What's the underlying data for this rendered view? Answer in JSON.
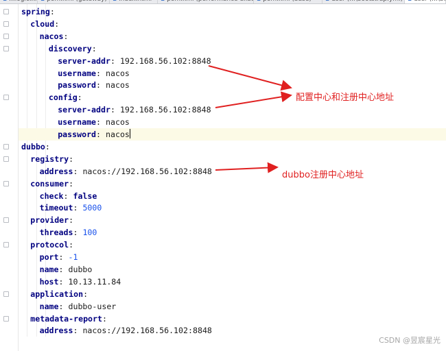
{
  "tabs": [
    {
      "label": "...logic.xml"
    },
    {
      "label": "pom.xml (gateway)"
    },
    {
      "label": "index.html"
    },
    {
      "label": "pom.xml (performance-alibaba)"
    },
    {
      "label": "pom.xml (base)"
    },
    {
      "label": "user (...\\bootstrap.yml)"
    },
    {
      "label": "user (...\\bo"
    }
  ],
  "code_lines": [
    {
      "indent": 0,
      "key": "spring",
      "value": "",
      "kind": ""
    },
    {
      "indent": 1,
      "key": "cloud",
      "value": "",
      "kind": ""
    },
    {
      "indent": 2,
      "key": "nacos",
      "value": "",
      "kind": ""
    },
    {
      "indent": 3,
      "key": "discovery",
      "value": "",
      "kind": ""
    },
    {
      "indent": 4,
      "key": "server-addr",
      "value": "192.168.56.102:8848",
      "kind": "str"
    },
    {
      "indent": 4,
      "key": "username",
      "value": "nacos",
      "kind": "str"
    },
    {
      "indent": 4,
      "key": "password",
      "value": "nacos",
      "kind": "str"
    },
    {
      "indent": 3,
      "key": "config",
      "value": "",
      "kind": ""
    },
    {
      "indent": 4,
      "key": "server-addr",
      "value": "192.168.56.102:8848",
      "kind": "str"
    },
    {
      "indent": 4,
      "key": "username",
      "value": "nacos",
      "kind": "str"
    },
    {
      "indent": 4,
      "key": "password",
      "value": "nacos",
      "kind": "str",
      "caret": true
    },
    {
      "indent": 0,
      "key": "dubbo",
      "value": "",
      "kind": ""
    },
    {
      "indent": 1,
      "key": "registry",
      "value": "",
      "kind": ""
    },
    {
      "indent": 2,
      "key": "address",
      "value": "nacos://192.168.56.102:8848",
      "kind": "str"
    },
    {
      "indent": 1,
      "key": "consumer",
      "value": "",
      "kind": ""
    },
    {
      "indent": 2,
      "key": "check",
      "value": "false",
      "kind": "bool"
    },
    {
      "indent": 2,
      "key": "timeout",
      "value": "5000",
      "kind": "num"
    },
    {
      "indent": 1,
      "key": "provider",
      "value": "",
      "kind": ""
    },
    {
      "indent": 2,
      "key": "threads",
      "value": "100",
      "kind": "num"
    },
    {
      "indent": 1,
      "key": "protocol",
      "value": "",
      "kind": ""
    },
    {
      "indent": 2,
      "key": "port",
      "value": "-1",
      "kind": "num"
    },
    {
      "indent": 2,
      "key": "name",
      "value": "dubbo",
      "kind": "str"
    },
    {
      "indent": 2,
      "key": "host",
      "value": "10.13.11.84",
      "kind": "str"
    },
    {
      "indent": 1,
      "key": "application",
      "value": "",
      "kind": ""
    },
    {
      "indent": 2,
      "key": "name",
      "value": "dubbo-user",
      "kind": "str"
    },
    {
      "indent": 1,
      "key": "metadata-report",
      "value": "",
      "kind": ""
    },
    {
      "indent": 2,
      "key": "address",
      "value": "nacos://192.168.56.102:8848",
      "kind": "str"
    }
  ],
  "current_line": 10,
  "annotations": {
    "nacos_note": "配置中心和注册中心地址",
    "dubbo_note": "dubbo注册中心地址"
  },
  "watermark": "CSDN @昱宸星光",
  "colors": {
    "annotation": "#e02020",
    "yaml_key": "#000080",
    "number": "#1750eb",
    "current_line_bg": "#fcfae6"
  }
}
